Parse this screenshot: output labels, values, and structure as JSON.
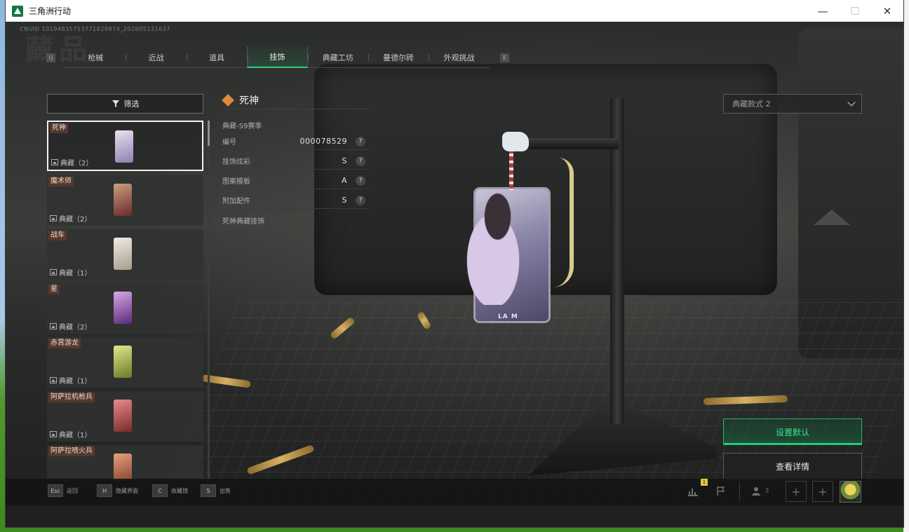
{
  "window": {
    "title": "三角洲行动",
    "controls": {
      "minimize": "—",
      "maximize": "☐",
      "close": "✕"
    }
  },
  "uid": "CNUID 10194835753771829874_202605131637",
  "page_title": "藏品",
  "tabs": {
    "prev_key": "Q",
    "next_key": "E",
    "items": [
      {
        "label": "枪械",
        "active": false
      },
      {
        "label": "近战",
        "active": false
      },
      {
        "label": "道具",
        "active": false
      },
      {
        "label": "挂饰",
        "active": true
      },
      {
        "label": "典藏工坊",
        "active": false
      },
      {
        "label": "曼德尔砖",
        "active": false
      },
      {
        "label": "外观挑战",
        "active": false
      }
    ]
  },
  "filter": {
    "label": "筛选",
    "icon": "filter-icon"
  },
  "charm_list": [
    {
      "name": "死神",
      "rarity": "典藏（2）",
      "selected": true,
      "color": "#c8b7d9"
    },
    {
      "name": "魔术师",
      "rarity": "典藏（2）",
      "selected": false,
      "color": "#9b3e3a"
    },
    {
      "name": "战车",
      "rarity": "典藏（1）",
      "selected": false,
      "color": "#d9d4cc"
    },
    {
      "name": "星",
      "rarity": "典藏（2）",
      "selected": false,
      "color": "#8c4fb0"
    },
    {
      "name": "赤霄游龙",
      "rarity": "典藏（1）",
      "selected": false,
      "color": "#b8c84a"
    },
    {
      "name": "阿萨拉机枪兵",
      "rarity": "典藏（1）",
      "selected": false,
      "color": "#c2444a"
    },
    {
      "name": "阿萨拉喷火兵",
      "rarity": "典藏（1）",
      "selected": false,
      "color": "#c2553a"
    }
  ],
  "detail": {
    "title": "死神",
    "season": "典藏-S9赛季",
    "rows": [
      {
        "label": "编号",
        "value": "000078529"
      },
      {
        "label": "挂饰炫彩",
        "value": "S"
      },
      {
        "label": "图案模板",
        "value": "A"
      },
      {
        "label": "附加配件",
        "value": "S"
      }
    ],
    "description": "死神典藏挂饰",
    "help_glyph": "?"
  },
  "style_select": {
    "value": "典藏款式 2"
  },
  "preview": {
    "card_label": "LA M"
  },
  "actions": {
    "set_default": "设置默认",
    "view_detail": "查看详情"
  },
  "bottom_hints": [
    {
      "key": "Esc",
      "label": "返回"
    },
    {
      "key": "H",
      "label": "隐藏界面"
    },
    {
      "key": "C",
      "label": "收藏馆"
    },
    {
      "key": "S",
      "label": "出售"
    }
  ],
  "system_bar": {
    "friends_count": "3",
    "level_tag": "1"
  },
  "colors": {
    "accent": "#27d07a",
    "accent_text": "#3ee48c",
    "name_tag": "#5a3a2e",
    "detail_diamond": "#e08a3c"
  }
}
